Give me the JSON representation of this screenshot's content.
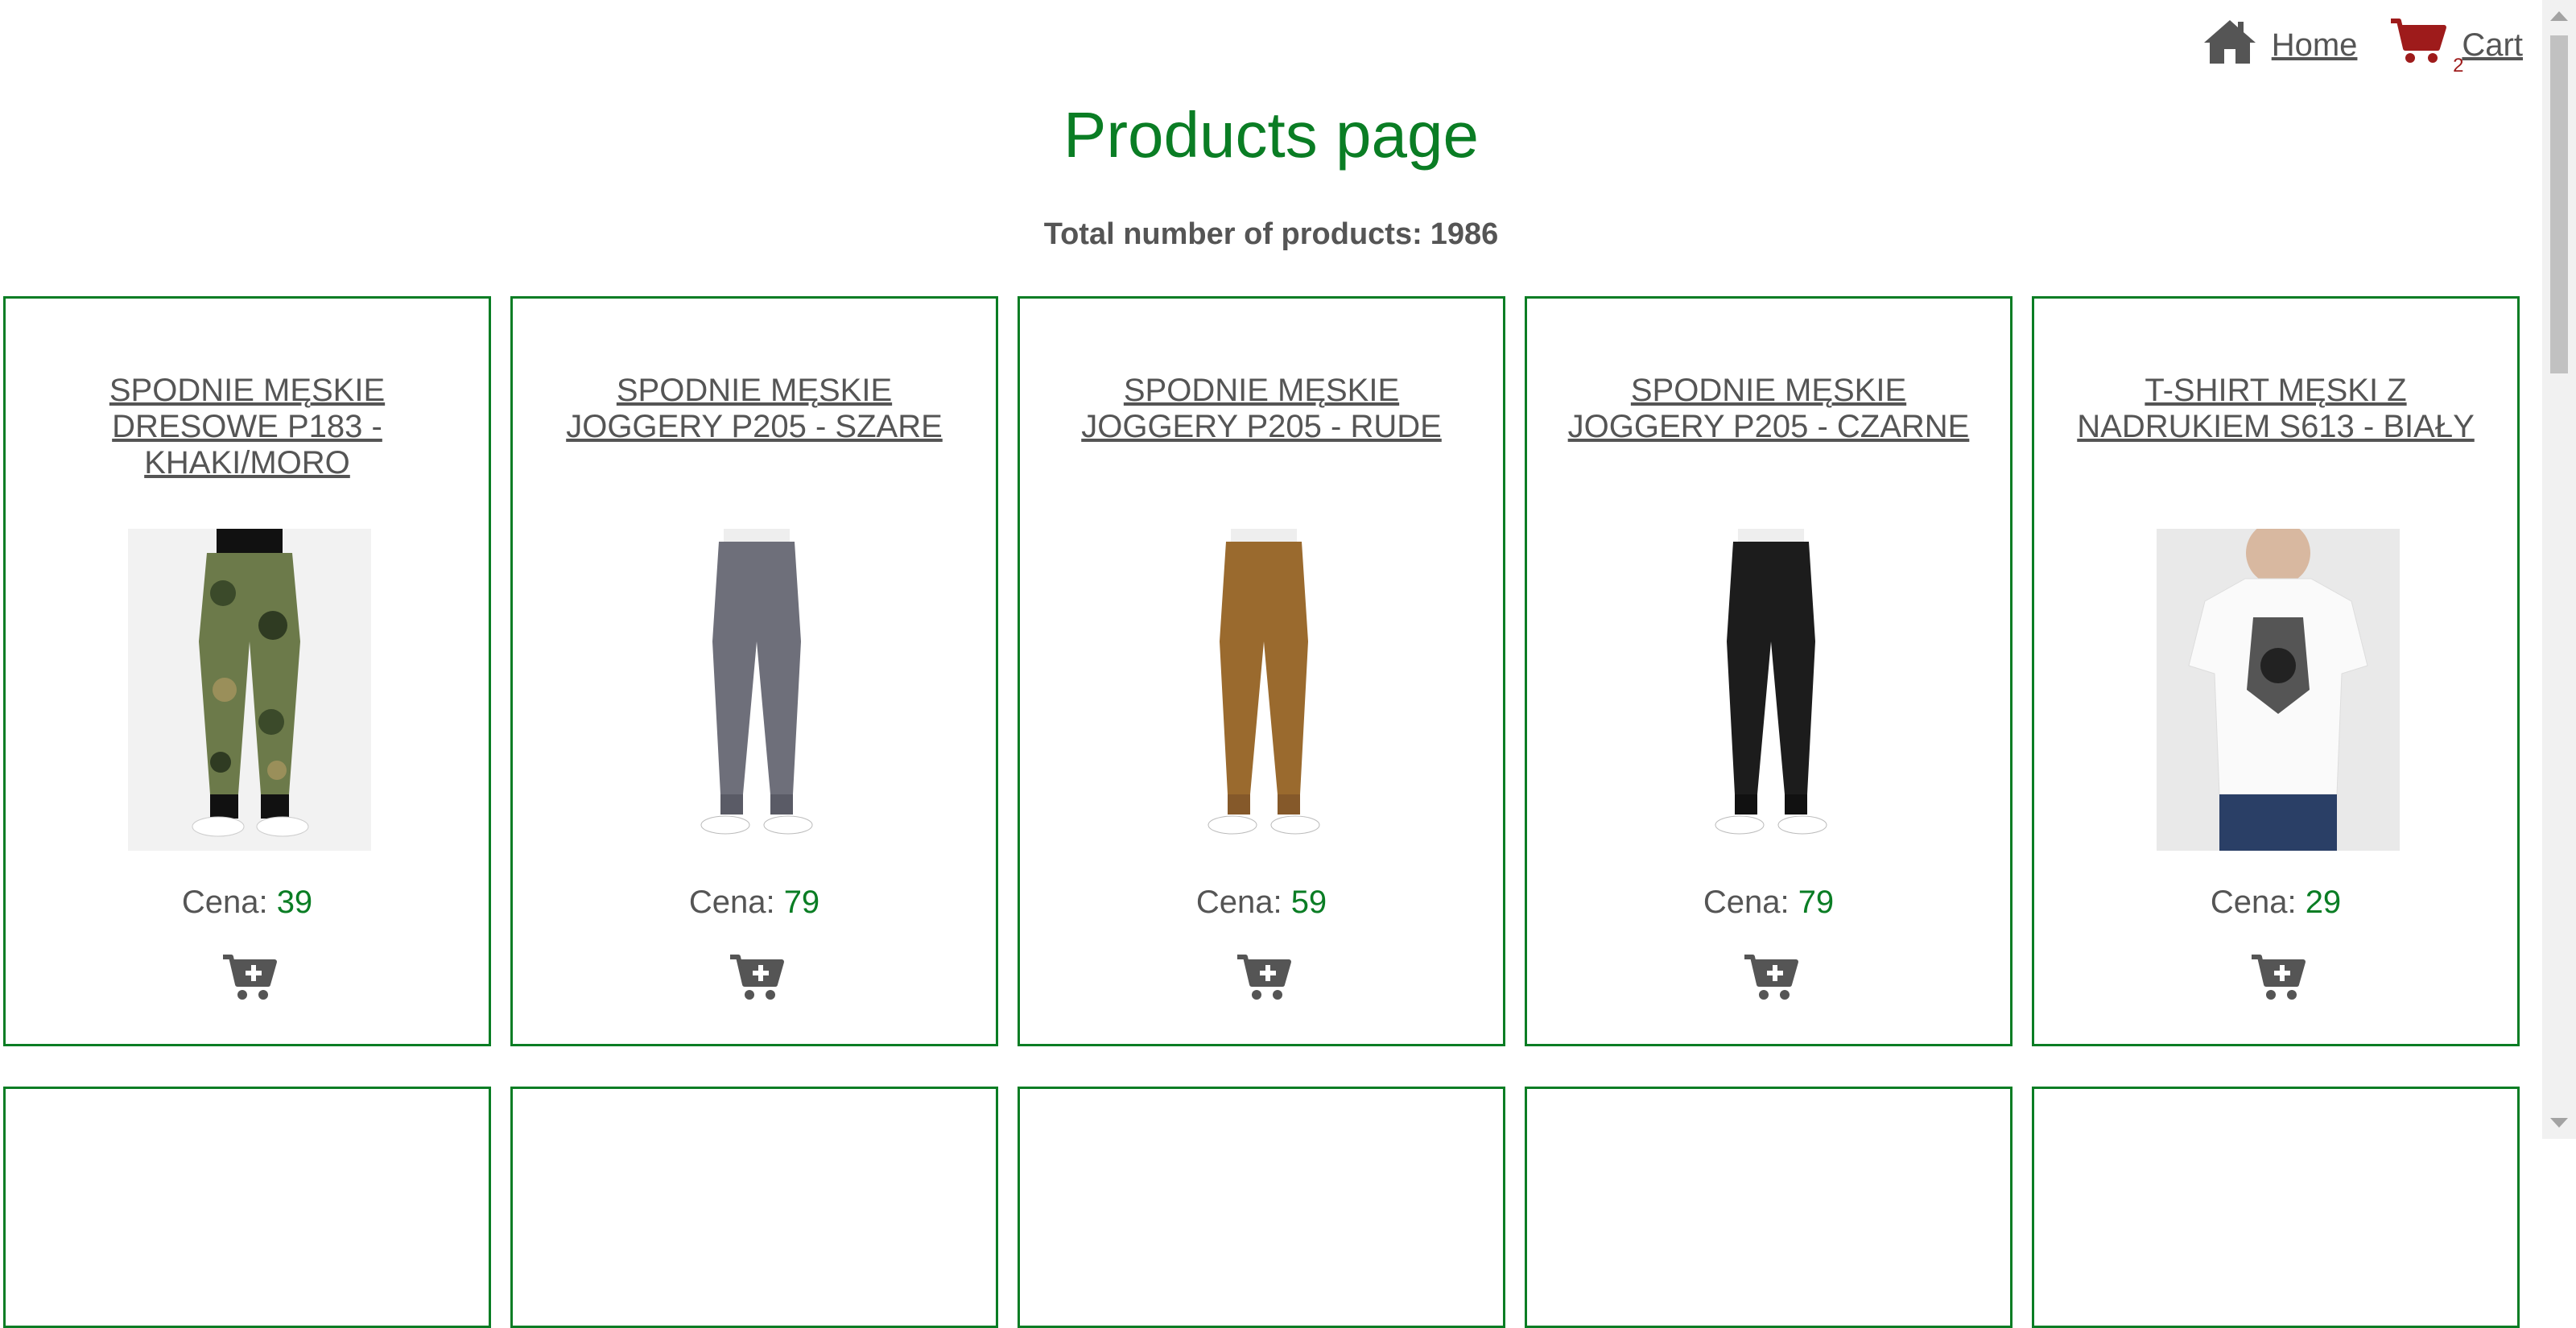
{
  "nav": {
    "home_label": "Home",
    "home_icon": "home-icon",
    "cart_label": "Cart",
    "cart_icon": "shopping-cart-icon",
    "cart_count": "2"
  },
  "page": {
    "title": "Products page",
    "total_label": "Total number of products:",
    "total_count": "1986"
  },
  "price_label": "Cena:",
  "products": [
    {
      "name": "SPODNIE MĘSKIE DRESOWE P183 - KHAKI/MORO",
      "price": "39",
      "image": "camo-pants"
    },
    {
      "name": "SPODNIE MĘSKIE JOGGERY P205 - SZARE",
      "price": "79",
      "image": "grey-joggers"
    },
    {
      "name": "SPODNIE MĘSKIE JOGGERY P205 - RUDE",
      "price": "59",
      "image": "rust-joggers"
    },
    {
      "name": "SPODNIE MĘSKIE JOGGERY P205 - CZARNE",
      "price": "79",
      "image": "black-joggers"
    },
    {
      "name": "T-SHIRT MĘSKI Z NADRUKIEM S613 - BIAŁY",
      "price": "29",
      "image": "white-tshirt"
    }
  ],
  "colors": {
    "accent": "#0a7d24",
    "cart_icon": "#9e1b1b",
    "text": "#555555"
  }
}
